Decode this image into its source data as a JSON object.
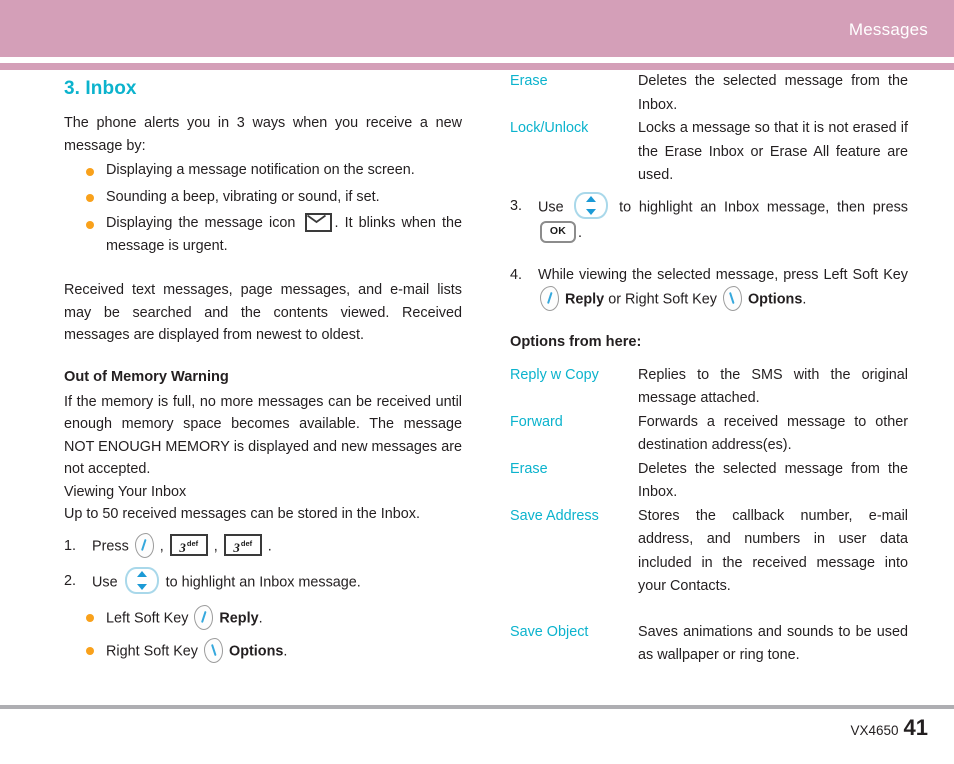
{
  "header": {
    "title": "Messages",
    "band_color": "#d49fb8"
  },
  "accent_colors": {
    "heading_cyan": "#0cb3cd",
    "bullet_orange": "#f9a11b",
    "body_text": "#231f20"
  },
  "left_column": {
    "section_title": "3. Inbox",
    "intro": "The phone alerts you in 3 ways when you receive a new message by:",
    "alert_bullets": [
      "Displaying a message notification on the screen.",
      "Sounding a beep, vibrating or sound, if set.",
      {
        "before_icon": "Displaying the message icon",
        "icon": "envelope-icon",
        "after_icon": ". It blinks when the message is urgent."
      }
    ],
    "received_para": "Received text messages, page messages, and e-mail lists may be searched and the contents viewed. Received messages are displayed from newest to oldest.",
    "memory_subhead": "Out of Memory Warning",
    "memory_para": "If the memory is full, no more messages can be received until enough memory space becomes available. The message NOT ENOUGH MEMORY is displayed and new messages are not accepted.",
    "viewing_line": "Viewing Your Inbox",
    "capacity_line": "Up to 50 received messages can be stored in the Inbox.",
    "steps": [
      {
        "num": "1.",
        "text_before": "Press",
        "keys": [
          "soft-key-left-icon",
          "key-3-def-icon",
          "key-3-def-icon"
        ],
        "text_after": "."
      },
      {
        "num": "2.",
        "text_before": "Use",
        "nav_icon": "nav-up-down-icon",
        "text_after": "to highlight an Inbox message."
      }
    ],
    "step2_bullets": [
      {
        "label": "Left Soft Key",
        "icon": "soft-key-left-icon",
        "action": "Reply",
        "period": "."
      },
      {
        "label": "Right Soft Key",
        "icon": "soft-key-right-icon",
        "action": "Options",
        "period": "."
      }
    ],
    "key_labels": {
      "digit": "3",
      "letters": "def"
    }
  },
  "right_column": {
    "top_options": [
      {
        "term": "Erase",
        "def": "Deletes the selected message from the Inbox."
      },
      {
        "term": "Lock/Unlock",
        "def": "Locks a message so that it is not erased if the Erase Inbox or Erase All feature are used."
      }
    ],
    "steps": [
      {
        "num": "3.",
        "text_before": "Use",
        "nav_icon": "nav-up-down-icon",
        "text_mid": "to highlight an Inbox message, then press",
        "ok_icon": "ok-key-icon",
        "ok_label": "OK",
        "text_after": "."
      },
      {
        "num": "4.",
        "text_before": "While viewing the selected message, press Left Soft Key",
        "left_icon": "soft-key-left-icon",
        "action_left": "Reply",
        "text_mid": "or Right Soft Key",
        "right_icon": "soft-key-right-icon",
        "action_right": "Options",
        "text_after": "."
      }
    ],
    "options_subhead": "Options from here:",
    "options": [
      {
        "term": "Reply w Copy",
        "def": "Replies to the SMS with the original message attached."
      },
      {
        "term": "Forward",
        "def": "Forwards a received message to other destination address(es)."
      },
      {
        "term": "Erase",
        "def": "Deletes the selected message from the Inbox."
      },
      {
        "term": "Save Address",
        "def": "Stores the callback number, e-mail address, and numbers in user data included in the received message into your Contacts."
      },
      {
        "term": "Save Object",
        "def": "Saves animations and sounds to be used as wallpaper or ring tone."
      }
    ]
  },
  "footer": {
    "model": "VX4650",
    "page_number": "41"
  }
}
